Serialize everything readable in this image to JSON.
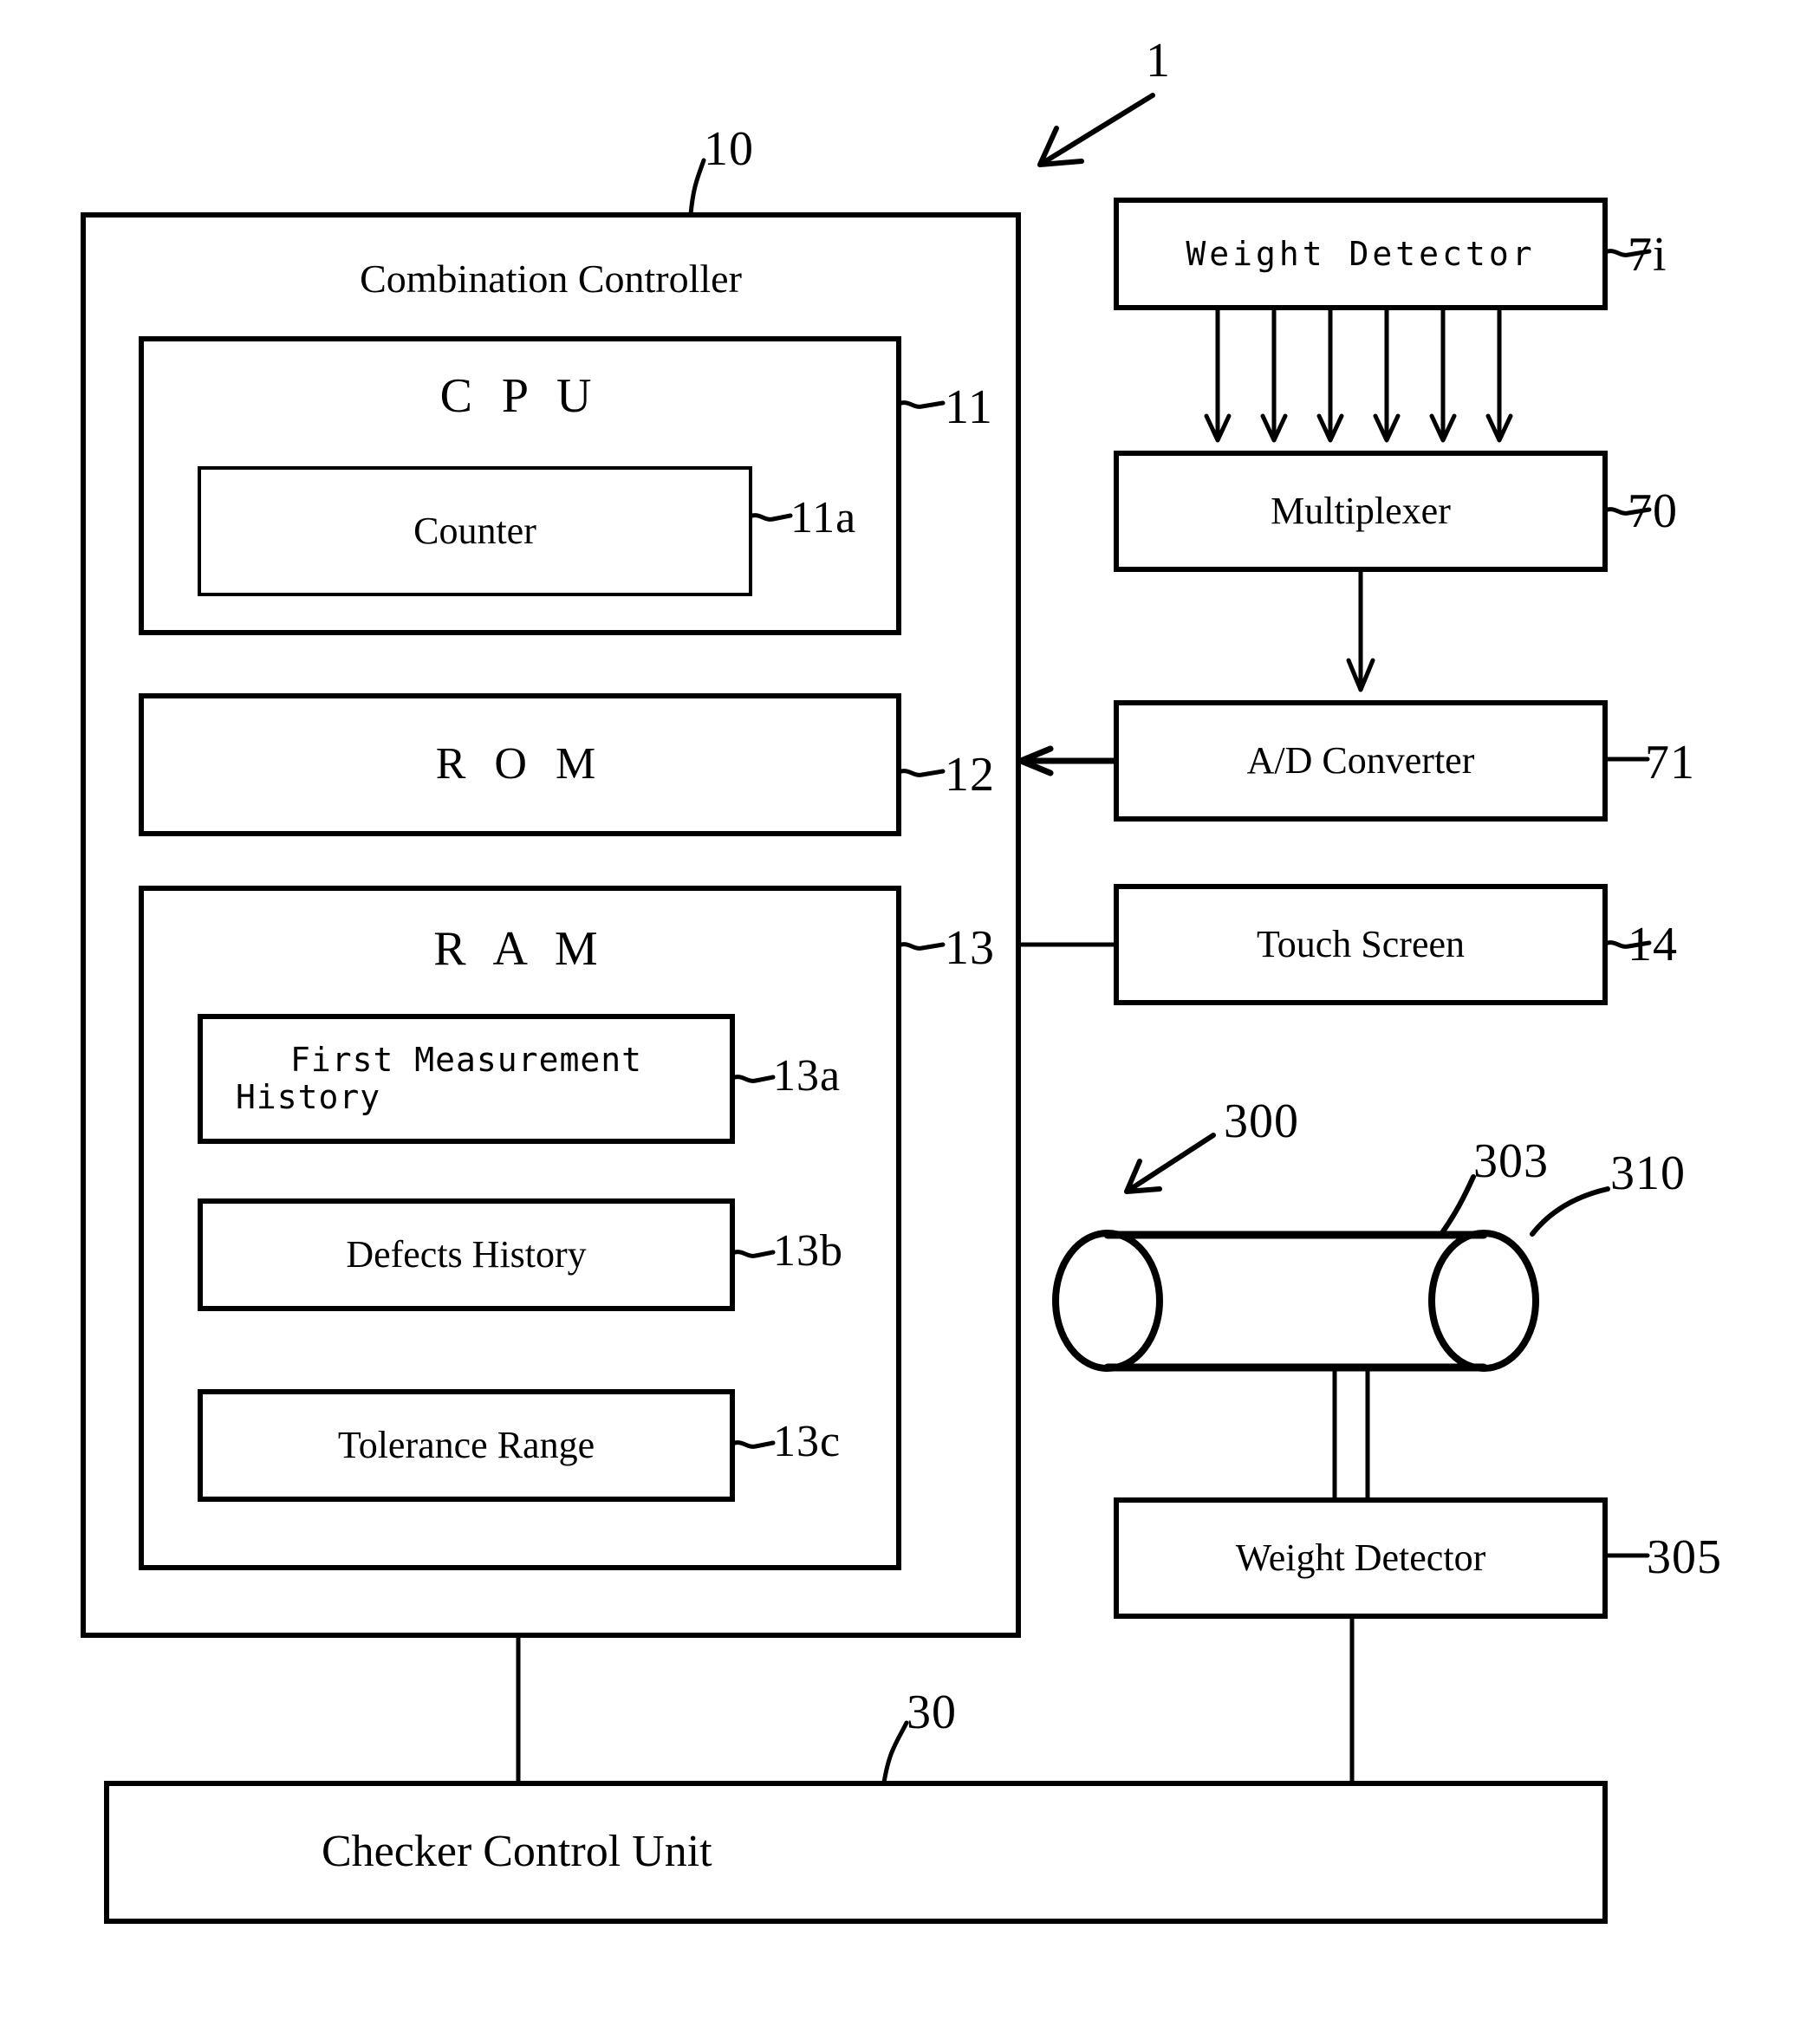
{
  "figure": {
    "system_ref": "1",
    "controller": {
      "title": "Combination Controller",
      "ref": "10",
      "cpu": {
        "label": "C P U",
        "ref": "11",
        "counter": {
          "label": "Counter",
          "ref": "11a"
        }
      },
      "rom": {
        "label": "R O M",
        "ref": "12"
      },
      "ram": {
        "label": "R A M",
        "ref": "13",
        "blocks": [
          {
            "label": "First Measurement History",
            "line1": "First Measurement",
            "line2": "History",
            "ref": "13a"
          },
          {
            "label": "Defects History",
            "ref": "13b"
          },
          {
            "label": "Tolerance Range",
            "ref": "13c"
          }
        ]
      }
    },
    "right_column": [
      {
        "label": "Weight Detector",
        "ref": "7i"
      },
      {
        "label": "Multiplexer",
        "ref": "70"
      },
      {
        "label": "A/D Converter",
        "ref": "71"
      },
      {
        "label": "Touch Screen",
        "ref": "14"
      }
    ],
    "conveyor": {
      "assembly_ref": "300",
      "belt_ref": "303",
      "roller_ref": "310",
      "weight_detector": {
        "label": "Weight Detector",
        "ref": "305"
      }
    },
    "checker": {
      "label": "Checker Control Unit",
      "ref": "30"
    },
    "multiplexer_input_arrows": 6,
    "colors": {
      "ink": "#000000",
      "paper": "#ffffff"
    }
  }
}
